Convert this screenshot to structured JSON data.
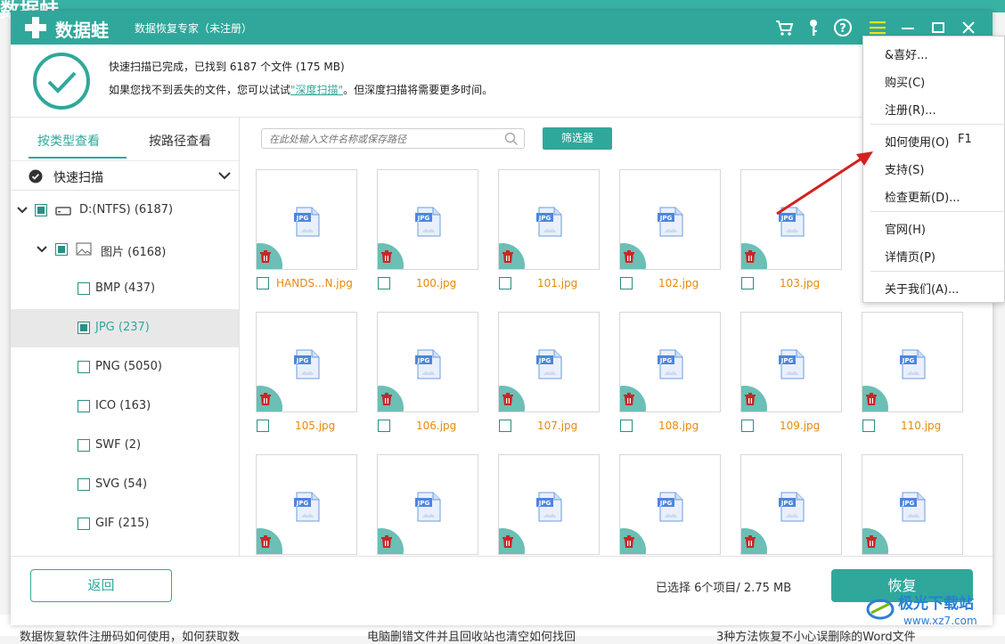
{
  "background": {
    "logo_fragment": "数据蛙",
    "articles": [
      "数据恢复软件注册码如何使用，如何获取数",
      "电脑删错文件并且回收站也清空如何找回",
      "3种方法恢复不小心误删除的Word文件"
    ]
  },
  "titlebar": {
    "logo": "数据蛙",
    "subtitle": "数据恢复专家（未注册）",
    "icons": [
      "cart-icon",
      "key-icon",
      "help-icon",
      "menu-icon",
      "minimize-icon",
      "maximize-icon",
      "close-icon"
    ]
  },
  "status": {
    "line1": "快速扫描已完成，已找到 6187 个文件 (175 MB)",
    "line2_prefix": "如果您找不到丢失的文件，您可以试试",
    "line2_link": "\"深度扫描\"",
    "line2_suffix": "。但深度扫描将需要更多时间。"
  },
  "sidebar": {
    "tabs": [
      "按类型查看",
      "按路径查看"
    ],
    "scan_mode": "快速扫描",
    "drive": "D:(NTFS) (6187)",
    "category": "图片 (6168)",
    "types": [
      "BMP (437)",
      "JPG (237)",
      "PNG (5050)",
      "ICO (163)",
      "SWF (2)",
      "SVG (54)",
      "GIF (215)"
    ]
  },
  "toolbar": {
    "search_placeholder": "在此处输入文件名称或保存路径",
    "filter_label": "筛选器"
  },
  "files": {
    "row1": [
      "HANDS...N.jpg",
      "100.jpg",
      "101.jpg",
      "102.jpg",
      "103.jpg"
    ],
    "row2": [
      "105.jpg",
      "106.jpg",
      "107.jpg",
      "108.jpg",
      "109.jpg",
      "110.jpg"
    ],
    "thumb_badge": "JPG"
  },
  "bottom": {
    "back_label": "返回",
    "selected_text": "已选择 6个项目/ 2.75 MB",
    "recover_label": "恢复"
  },
  "menu": {
    "items": [
      "&喜好...",
      "购买(C)",
      "注册(R)...",
      "如何使用(O)",
      "支持(S)",
      "检查更新(D)...",
      "官网(H)",
      "详情页(P)",
      "关于我们(A)..."
    ],
    "shortcut": "F1"
  },
  "watermark": {
    "text": "极光下载站",
    "url": "www.xz7.com"
  },
  "colors": {
    "brand": "#2fa89b",
    "file_name": "#e8890c",
    "trash_badge": "#6bbfb5",
    "arrow": "#d42020"
  }
}
